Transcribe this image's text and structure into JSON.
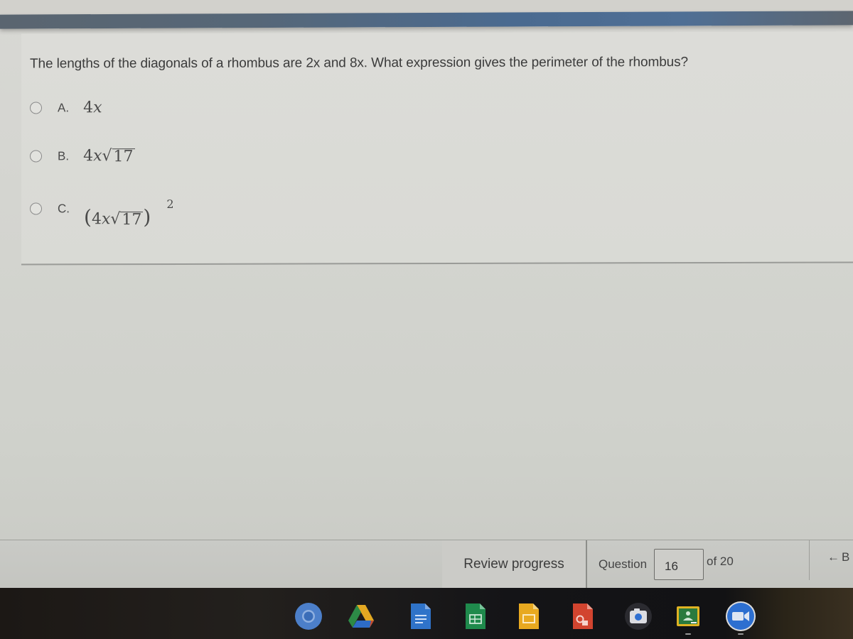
{
  "question": {
    "text": "The lengths of the diagonals of a rhombus are 2x and 8x. What expression gives the perimeter of the rhombus?",
    "options": [
      {
        "letter": "A.",
        "coef": "4",
        "var": "x",
        "radicand": "",
        "exponent": "",
        "selected": false
      },
      {
        "letter": "B.",
        "coef": "4",
        "var": "x",
        "radicand": "17",
        "exponent": "",
        "selected": false
      },
      {
        "letter": "C.",
        "coef": "4",
        "var": "x",
        "radicand": "17",
        "exponent": "2",
        "selected": false
      }
    ]
  },
  "footer": {
    "review_label": "Review progress",
    "question_label": "Question",
    "question_number": "16",
    "of_label": "of 20",
    "back_label": "B"
  },
  "shelf": {
    "apps": [
      "chromium-icon",
      "google-drive-icon",
      "google-docs-icon",
      "google-sheets-icon",
      "google-slides-icon",
      "google-drawings-icon",
      "camera-icon",
      "google-classroom-icon",
      "zoom-icon"
    ],
    "running": [
      "google-classroom-icon",
      "zoom-icon"
    ]
  },
  "colors": {
    "accent_bar": "#4f6f95",
    "docs": "#2f73c9",
    "sheets": "#1f8a4c",
    "slides": "#e8a920",
    "drawings": "#d2442f",
    "zoom": "#2d6fd0",
    "classroom": "#2a7a3e"
  }
}
